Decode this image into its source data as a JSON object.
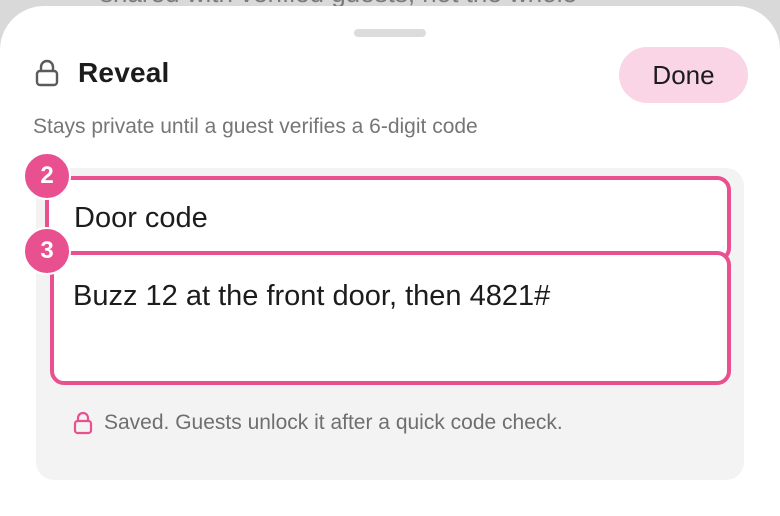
{
  "background": {
    "partial_text": "shared with verified guests, not the whole"
  },
  "sheet": {
    "title": "Reveal",
    "title_icon": "lock-icon",
    "done_label": "Done",
    "subtitle": "Stays private until a guest verifies a 6-digit code"
  },
  "fields": {
    "label": {
      "badge": "2",
      "value": "Door code"
    },
    "content": {
      "badge": "3",
      "value": "Buzz 12 at the front door, then 4821#"
    }
  },
  "status": {
    "icon": "lock-icon",
    "text": "Saved. Guests unlock it after a quick code check."
  },
  "colors": {
    "accent": "#e8508f",
    "done_bg": "#f9d5e5",
    "card_bg": "#f3f3f3",
    "muted_text": "#767676"
  }
}
